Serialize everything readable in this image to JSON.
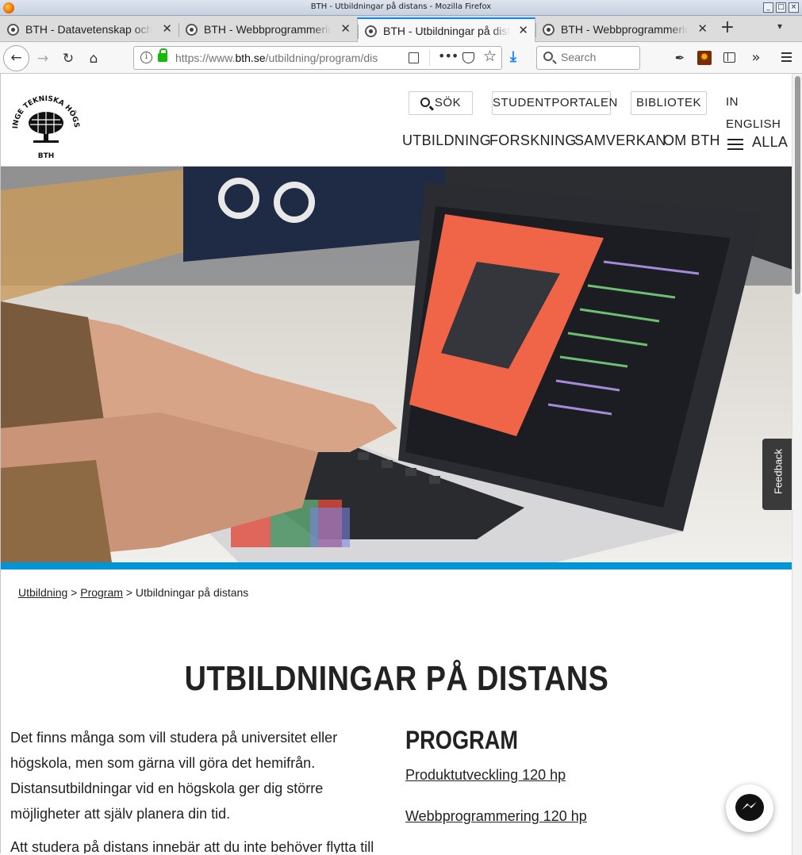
{
  "window": {
    "title": "BTH - Utbildningar på distans - Mozilla Firefox"
  },
  "tabs": [
    {
      "label": "BTH - Datavetenskap och",
      "active": false
    },
    {
      "label": "BTH - Webbprogrammering",
      "active": false
    },
    {
      "label": "BTH - Utbildningar på distans",
      "active": true
    },
    {
      "label": "BTH - Webbprogrammering",
      "active": false
    }
  ],
  "navbar": {
    "url_prefix": "https://www.",
    "url_domain": "bth.se",
    "url_path": "/utbildning/program/distans",
    "search_placeholder": "Search"
  },
  "site": {
    "logo_top": "BLEKINGE TEKNISKA HÖGSKOLA",
    "logo_bottom": "BTH",
    "util": {
      "search": "SÖK",
      "studentportal": "STUDENTPORTALEN",
      "library": "BIBLIOTEK",
      "english": "IN ENGLISH"
    },
    "nav": [
      "UTBILDNING",
      "FORSKNING",
      "SAMVERKAN",
      "OM BTH",
      "ALLA"
    ],
    "feedback": "Feedback",
    "accent_color": "#0095d6"
  },
  "breadcrumb": {
    "items": [
      "Utbildning",
      "Program"
    ],
    "sep": ">",
    "current": "Utbildningar på distans"
  },
  "page": {
    "title": "UTBILDNINGAR PÅ DISTANS",
    "intro": "Det finns många som vill studera på universitet eller högskola, men som gärna vill göra det hemifrån. Distansutbildningar vid en högskola ger dig större möjligheter att själv planera din tid.",
    "intro2": "Att studera på distans innebär att du inte behöver flytta till studieorten för att läsa",
    "program_heading": "PROGRAM",
    "programs": [
      "Produktutveckling 120 hp",
      "Webbprogrammering 120 hp"
    ]
  }
}
